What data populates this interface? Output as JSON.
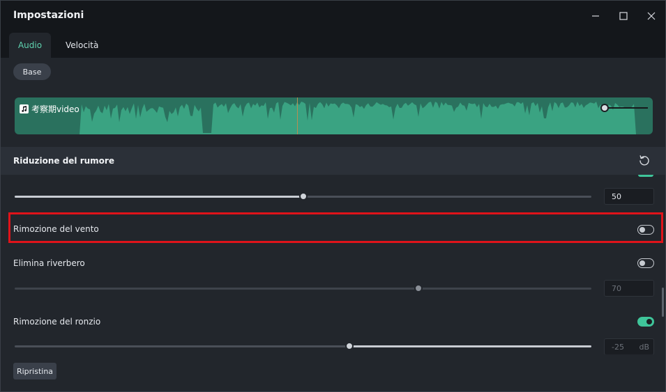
{
  "window": {
    "title": "Impostazioni"
  },
  "tabs": [
    {
      "label": "Audio",
      "active": true
    },
    {
      "label": "Velocità",
      "active": false
    }
  ],
  "subtab": {
    "label": "Base"
  },
  "clip": {
    "name": "考察期video",
    "icon": "music-note-icon"
  },
  "noise_section": {
    "title": "Riduzione del rumore"
  },
  "noise_level": {
    "value": "50",
    "fraction": 0.5
  },
  "wind": {
    "label": "Rimozione del vento",
    "enabled": false
  },
  "reverb": {
    "label": "Elimina riverbero",
    "enabled": false,
    "value": "70",
    "fraction": 0.7
  },
  "hum": {
    "label": "Rimozione del ronzio",
    "enabled": true,
    "value": "-25",
    "unit": "dB",
    "fraction": 0.58
  },
  "footer": {
    "reset_label": "Ripristina"
  },
  "colors": {
    "accent": "#3fc59a",
    "waveform": "#3aa382",
    "highlight": "#e0131a"
  }
}
